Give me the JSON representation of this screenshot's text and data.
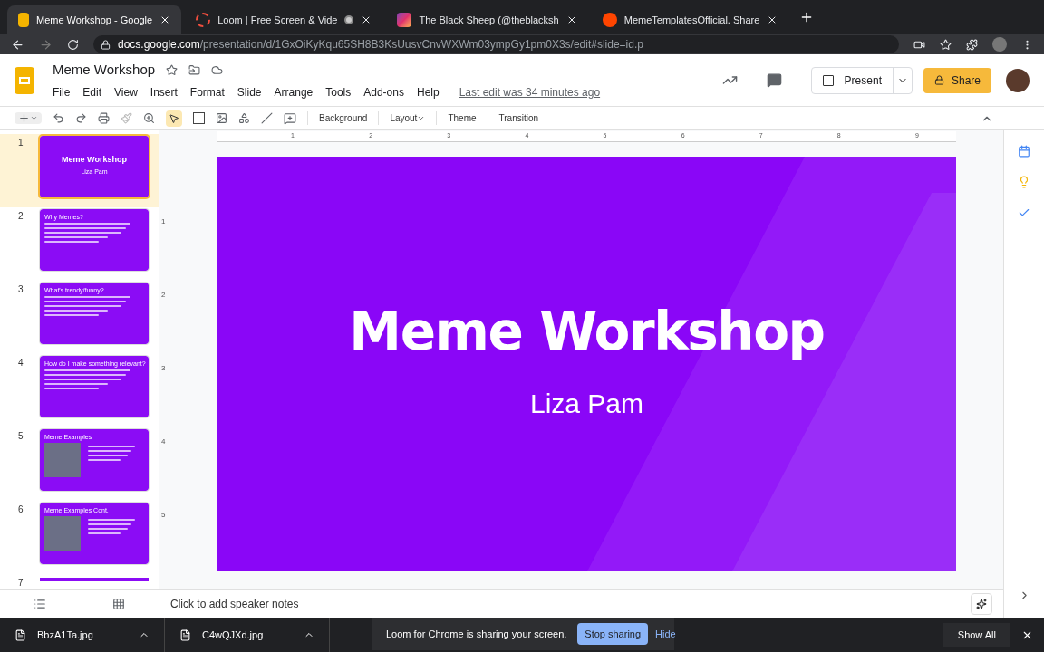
{
  "browser": {
    "tabs": [
      {
        "title": "Meme Workshop - Google",
        "selected": true
      },
      {
        "title": "Loom | Free Screen & Vide",
        "selected": false,
        "recording": true
      },
      {
        "title": "The Black Sheep (@theblacksh",
        "selected": false
      },
      {
        "title": "MemeTemplatesOfficial. Share",
        "selected": false
      }
    ],
    "url": {
      "host": "docs.google.com",
      "path": "/presentation/d/1GxOiKyKqu65SH8B3KsUusvCnvWXWm03ympGy1pm0X3s/edit#slide=id.p"
    }
  },
  "doc": {
    "title": "Meme Workshop",
    "menus": [
      "File",
      "Edit",
      "View",
      "Insert",
      "Format",
      "Slide",
      "Arrange",
      "Tools",
      "Add-ons",
      "Help"
    ],
    "last_edit": "Last edit was 34 minutes ago",
    "present": "Present",
    "share": "Share"
  },
  "toolbar": {
    "buttons": [
      {
        "label": "Background",
        "dropdown": false
      },
      {
        "label": "Layout",
        "dropdown": true
      },
      {
        "label": "Theme",
        "dropdown": false
      },
      {
        "label": "Transition",
        "dropdown": false
      }
    ]
  },
  "ruler": {
    "horizontal": [
      "1",
      "2",
      "3",
      "4",
      "5",
      "6",
      "7",
      "8",
      "9"
    ],
    "vertical": [
      "1",
      "2",
      "3",
      "4",
      "5"
    ]
  },
  "slides": [
    {
      "number": "1",
      "kind": "title",
      "title": "Meme Workshop",
      "subtitle": "Liza Pam",
      "selected": true
    },
    {
      "number": "2",
      "kind": "bullets",
      "title": "Why Memes?",
      "selected": false
    },
    {
      "number": "3",
      "kind": "bullets",
      "title": "What's trendy/funny?",
      "selected": false
    },
    {
      "number": "4",
      "kind": "bullets",
      "title": "How do I make something relevant?",
      "selected": false
    },
    {
      "number": "5",
      "kind": "image",
      "title": "Meme Examples",
      "selected": false
    },
    {
      "number": "6",
      "kind": "image",
      "title": "Meme Examples Cont.",
      "selected": false
    },
    {
      "number": "7",
      "kind": "partial",
      "selected": false
    }
  ],
  "main_slide": {
    "title": "Meme Workshop",
    "subtitle": "Liza Pam"
  },
  "speaker_notes": {
    "placeholder": "Click to add speaker notes"
  },
  "downloads": [
    {
      "name": "BbzA1Ta.jpg"
    },
    {
      "name": "C4wQJXd.jpg"
    }
  ],
  "show_all": "Show All",
  "loom_banner": {
    "message": "Loom for Chrome is sharing your screen.",
    "stop": "Stop sharing",
    "hide": "Hide"
  }
}
